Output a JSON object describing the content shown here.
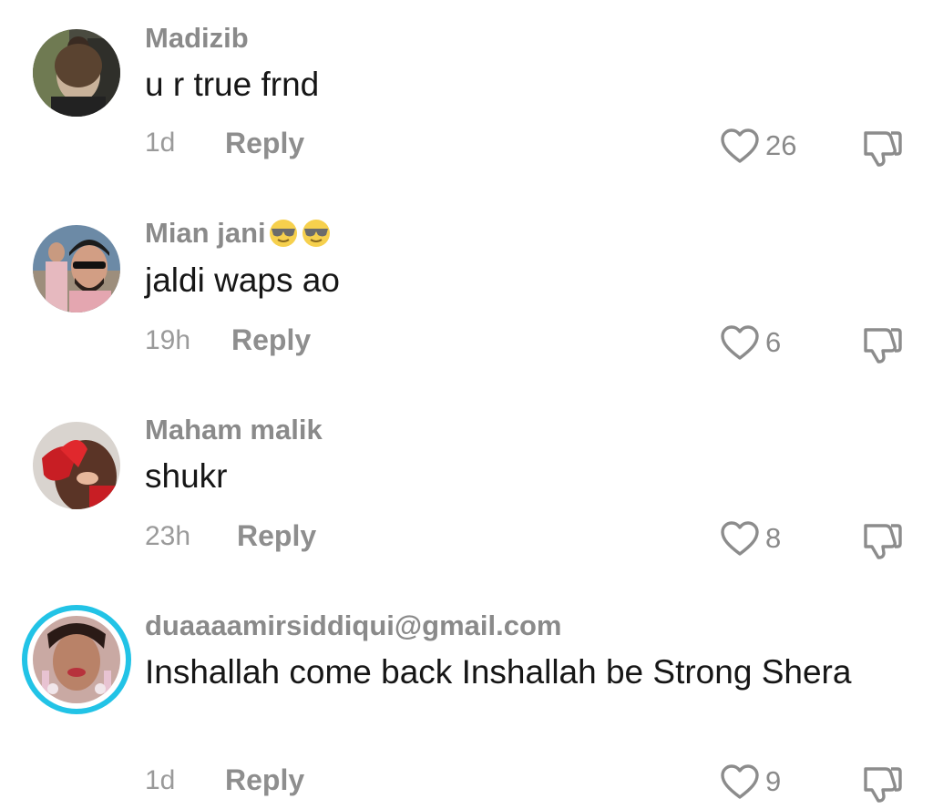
{
  "comments": [
    {
      "username": "Madizib",
      "text": "u r true frnd",
      "time": "1d",
      "reply_label": "Reply",
      "likes": "26",
      "avatar_icon": "user-avatar-photo"
    },
    {
      "username": "Mian jani",
      "username_emoji": "smiling-face-with-sunglasses",
      "text": "jaldi waps ao",
      "time": "19h",
      "reply_label": "Reply",
      "likes": "6",
      "avatar_icon": "user-avatar-photo"
    },
    {
      "username": "Maham malik",
      "text": "shukr",
      "time": "23h",
      "reply_label": "Reply",
      "likes": "8",
      "avatar_icon": "user-avatar-photo"
    },
    {
      "username": "duaaaamirsiddiqui@gmail.com",
      "text": "Inshallah come back Inshallah be Strong Shera",
      "time": "1d",
      "reply_label": "Reply",
      "likes": "9",
      "avatar_icon": "user-avatar-photo-story-ring",
      "story_ring_color": "#22c3e6"
    }
  ],
  "icons": {
    "like": "heart-outline-icon",
    "dislike": "thumbs-down-outline-icon"
  },
  "colors": {
    "username": "#8a8a8a",
    "text": "#161616",
    "meta": "#9a9a9a"
  }
}
